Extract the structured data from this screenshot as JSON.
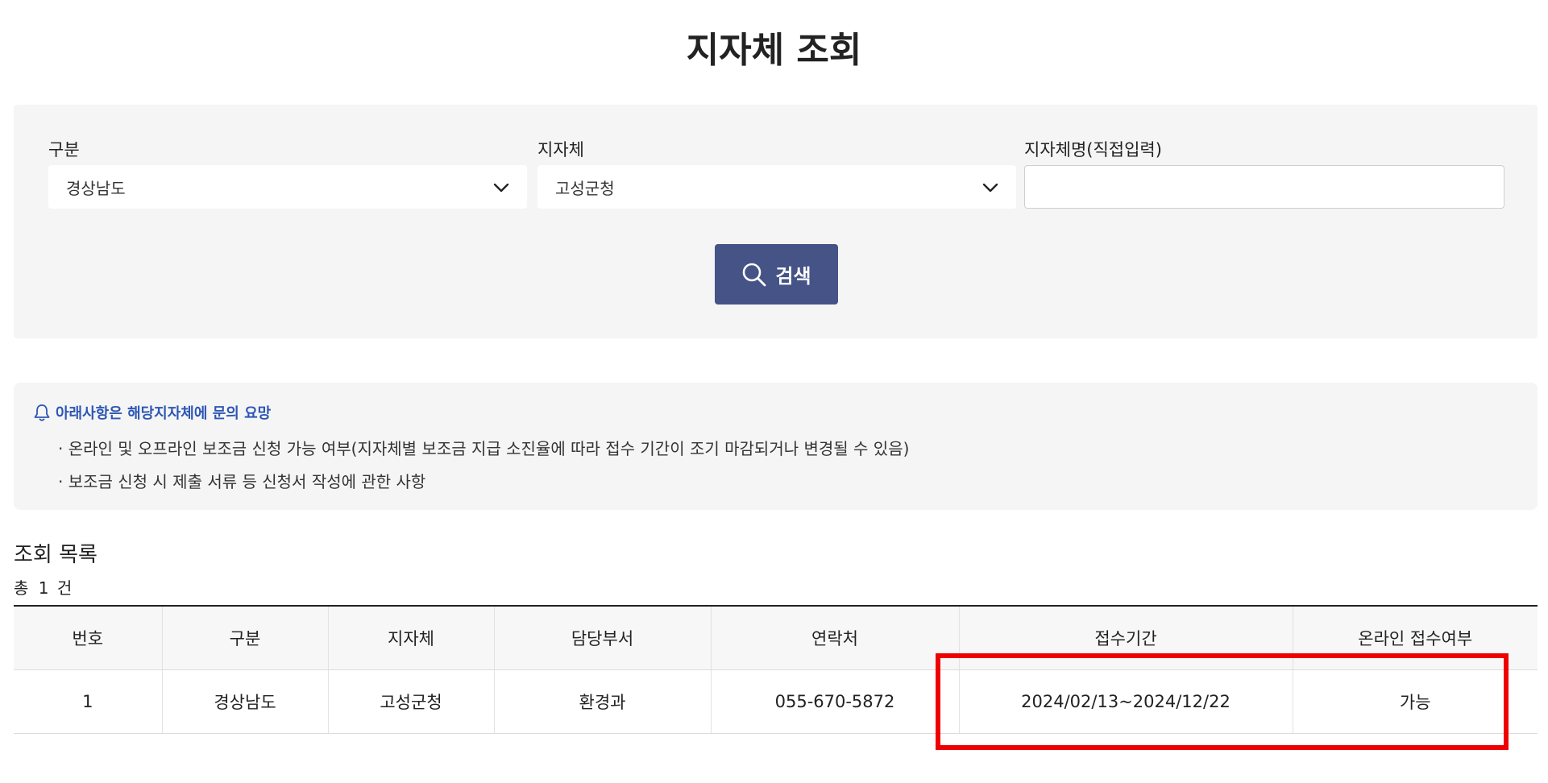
{
  "page": {
    "title": "지자체 조회"
  },
  "search": {
    "category_label": "구분",
    "category_value": "경상남도",
    "municipality_label": "지자체",
    "municipality_value": "고성군청",
    "name_label": "지자체명(직접입력)",
    "name_value": "",
    "button_label": "검색"
  },
  "notice": {
    "heading": "아래사항은 해당지자체에 문의 요망",
    "lines": [
      "· 온라인 및 오프라인 보조금 신청 가능 여부(지자체별 보조금 지급 소진율에 따라 접수 기간이 조기 마감되거나 변경될 수 있음)",
      "· 보조금 신청 시 제출 서류 등 신청서 작성에 관한 사항"
    ]
  },
  "results": {
    "title": "조회 목록",
    "count_prefix": "총",
    "count": "1",
    "count_suffix": "건",
    "columns": [
      "번호",
      "구분",
      "지자체",
      "담당부서",
      "연락처",
      "접수기간",
      "온라인 접수여부"
    ],
    "rows": [
      [
        "1",
        "경상남도",
        "고성군청",
        "환경과",
        "055-670-5872",
        "2024/02/13~2024/12/22",
        "가능"
      ]
    ]
  },
  "colors": {
    "button_bg": "#455386",
    "notice_heading": "#2d56b5",
    "highlight": "#ee0000"
  }
}
